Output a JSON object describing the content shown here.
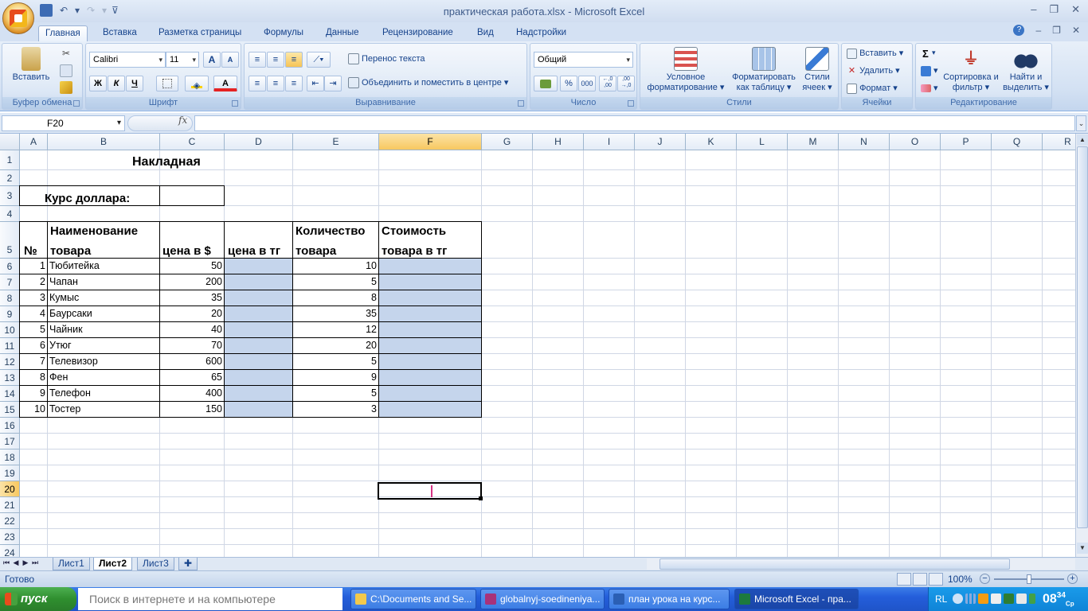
{
  "window": {
    "title": "практическая работа.xlsx - Microsoft Excel"
  },
  "ribbon": {
    "tabs": [
      "Главная",
      "Вставка",
      "Разметка страницы",
      "Формулы",
      "Данные",
      "Рецензирование",
      "Вид",
      "Надстройки"
    ],
    "active_tab": "Главная",
    "clipboard": {
      "paste_label": "Вставить",
      "group_label": "Буфер обмена"
    },
    "font": {
      "name": "Calibri",
      "size": "11",
      "bold": "Ж",
      "italic": "К",
      "underline": "Ч",
      "grow": "A",
      "shrink": "A",
      "group_label": "Шрифт",
      "font_color_label": "A"
    },
    "alignment": {
      "wrap_text": "Перенос текста",
      "merge_center": "Объединить и поместить в центре",
      "group_label": "Выравнивание"
    },
    "number": {
      "format": "Общий",
      "percent": "%",
      "thousands": "000",
      "inc_decimal": "←,0\n,00",
      "dec_decimal": ",00\n→,0",
      "group_label": "Число"
    },
    "styles": {
      "conditional": "Условное форматирование",
      "format_table": "Форматировать как таблицу",
      "cell_styles": "Стили ячеек",
      "group_label": "Стили"
    },
    "cells": {
      "insert": "Вставить",
      "delete": "Удалить",
      "format": "Формат",
      "group_label": "Ячейки"
    },
    "editing": {
      "sum": "Σ",
      "sort_filter": "Сортировка и фильтр",
      "find_select": "Найти и выделить",
      "group_label": "Редактирование"
    }
  },
  "formula_bar": {
    "name_box": "F20",
    "fx": "fx",
    "content": ""
  },
  "sheet": {
    "columns": [
      "A",
      "B",
      "C",
      "D",
      "E",
      "F",
      "G",
      "H",
      "I",
      "J",
      "K",
      "L",
      "M",
      "N",
      "O",
      "P",
      "Q",
      "R"
    ],
    "selected_column": "F",
    "rows": [
      "1",
      "2",
      "3",
      "4",
      "5",
      "6",
      "7",
      "8",
      "9",
      "10",
      "11",
      "12",
      "13",
      "14",
      "15",
      "16",
      "17",
      "18",
      "19",
      "20",
      "21",
      "22",
      "23",
      "24"
    ],
    "selected_row": "20",
    "title": "Накладная",
    "rate_label": "Курс доллара:",
    "headers": {
      "num": "№",
      "name_line1": "Наименование",
      "name_line2": "товара",
      "price_usd": "цена в $",
      "price_kzt": "цена в тг",
      "qty_line1": "Количество",
      "qty_line2": "товара",
      "cost_line1": "Стоимость",
      "cost_line2": "товара в тг"
    },
    "items": [
      {
        "n": "1",
        "name": "Тюбитейка",
        "price": "50",
        "qty": "10"
      },
      {
        "n": "2",
        "name": "Чапан",
        "price": "200",
        "qty": "5"
      },
      {
        "n": "3",
        "name": "Кумыс",
        "price": "35",
        "qty": "8"
      },
      {
        "n": "4",
        "name": "Баурсаки",
        "price": "20",
        "qty": "35"
      },
      {
        "n": "5",
        "name": "Чайник",
        "price": "40",
        "qty": "12"
      },
      {
        "n": "6",
        "name": "Утюг",
        "price": "70",
        "qty": "20"
      },
      {
        "n": "7",
        "name": "Телевизор",
        "price": "600",
        "qty": "5"
      },
      {
        "n": "8",
        "name": "Фен",
        "price": "65",
        "qty": "9"
      },
      {
        "n": "9",
        "name": "Телефон",
        "price": "400",
        "qty": "5"
      },
      {
        "n": "10",
        "name": "Тостер",
        "price": "150",
        "qty": "3"
      }
    ],
    "fill_color": "#c5d5ec"
  },
  "sheet_tabs": {
    "tabs": [
      "Лист1",
      "Лист2",
      "Лист3"
    ],
    "active": "Лист2"
  },
  "status_bar": {
    "ready": "Готово",
    "zoom": "100%"
  },
  "taskbar": {
    "start": "пуск",
    "search_placeholder": "Поиск в интернете и на компьютере",
    "tasks": [
      {
        "label": "C:\\Documents and Se...",
        "icon_color": "#f2c94c"
      },
      {
        "label": "globalnyj-soedineniya...",
        "icon_color": "#a8327a"
      },
      {
        "label": "план урока на курс...",
        "icon_color": "#2b5fb4"
      },
      {
        "label": "Microsoft Excel - пра...",
        "icon_color": "#1d7a3d"
      }
    ],
    "lang": "RL",
    "time_hh": "08",
    "time_mm": "34",
    "day": "Ср"
  }
}
